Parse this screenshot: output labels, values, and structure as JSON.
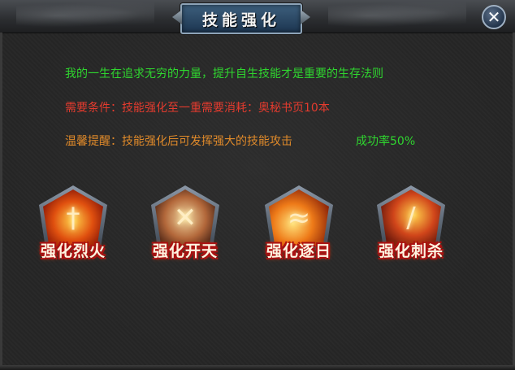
{
  "window": {
    "title": "技能强化"
  },
  "close_icon": "close-icon",
  "info": {
    "motto": "我的一生在追求无穷的力量，提升自生技能才是重要的生存法则",
    "requirement_label": "需要条件：",
    "requirement_text": "技能强化至一重需要消耗：奥秘书页10本",
    "tip_label": "温馨提醒：",
    "tip_text": "技能强化后可发挥强大的技能攻击",
    "success_rate": "成功率50%"
  },
  "skills": [
    {
      "label": "强化烈火",
      "icon": "flame-sword-icon"
    },
    {
      "label": "强化开天",
      "icon": "cleave-sky-icon"
    },
    {
      "label": "强化逐日",
      "icon": "chase-sun-icon"
    },
    {
      "label": "强化刺杀",
      "icon": "assassinate-icon"
    }
  ],
  "colors": {
    "motto": "#2fd62f",
    "requirement": "#e43b2e",
    "tip": "#e08a2a",
    "success_rate": "#2fd62f"
  }
}
